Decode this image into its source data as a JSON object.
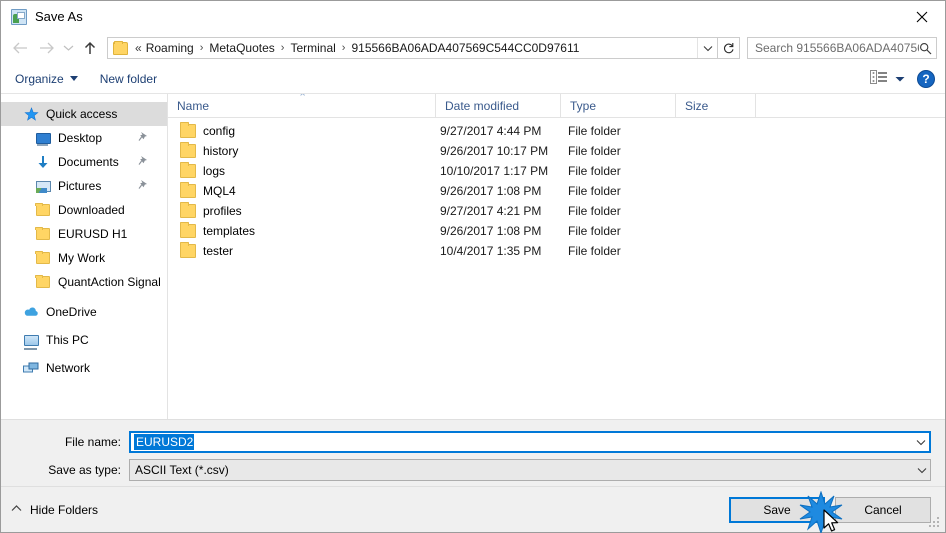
{
  "window": {
    "title": "Save As",
    "title_icon": "save-as-app-icon",
    "close_icon": "close-icon"
  },
  "navigation": {
    "back_icon": "back-arrow-icon",
    "forward_icon": "forward-arrow-icon",
    "recent_icon": "recent-locations-chevron-icon",
    "up_icon": "up-arrow-icon",
    "breadcrumb_folder_icon": "folder-icon",
    "breadcrumb_overflow": "«",
    "breadcrumbs": [
      "Roaming",
      "MetaQuotes",
      "Terminal",
      "915566BA06ADA407569C544CC0D97611"
    ],
    "separator": "›",
    "address_dropdown_icon": "chevron-down-icon",
    "refresh_icon": "refresh-icon"
  },
  "search": {
    "placeholder": "Search 915566BA06ADA40756...",
    "icon": "search-icon"
  },
  "commandbar": {
    "organize": "Organize",
    "new_folder": "New folder",
    "view_icon": "view-layout-icon",
    "view_dropdown_icon": "chevron-down-icon",
    "help_icon": "help-icon",
    "help_label": "?"
  },
  "sidebar": {
    "items": [
      {
        "label": "Quick access",
        "icon": "star-icon",
        "selected": true,
        "indent": false,
        "pinned": false
      },
      {
        "label": "Desktop",
        "icon": "desktop-icon",
        "selected": false,
        "indent": true,
        "pinned": true
      },
      {
        "label": "Documents",
        "icon": "documents-download-icon",
        "selected": false,
        "indent": true,
        "pinned": true
      },
      {
        "label": "Pictures",
        "icon": "pictures-icon",
        "selected": false,
        "indent": true,
        "pinned": true
      },
      {
        "label": "Downloaded",
        "icon": "folder-icon",
        "selected": false,
        "indent": true,
        "pinned": false
      },
      {
        "label": "EURUSD H1",
        "icon": "folder-icon",
        "selected": false,
        "indent": true,
        "pinned": false
      },
      {
        "label": "My Work",
        "icon": "folder-icon",
        "selected": false,
        "indent": true,
        "pinned": false
      },
      {
        "label": "QuantAction Signal",
        "icon": "folder-icon",
        "selected": false,
        "indent": true,
        "pinned": false
      },
      {
        "label": "OneDrive",
        "icon": "onedrive-cloud-icon",
        "selected": false,
        "indent": false,
        "pinned": false
      },
      {
        "label": "This PC",
        "icon": "this-pc-icon",
        "selected": false,
        "indent": false,
        "pinned": false
      },
      {
        "label": "Network",
        "icon": "network-icon",
        "selected": false,
        "indent": false,
        "pinned": false
      }
    ]
  },
  "filelist": {
    "columns": [
      "Name",
      "Date modified",
      "Type",
      "Size"
    ],
    "sort_indicator": "⌃",
    "rows": [
      {
        "name": "config",
        "date": "9/27/2017 4:44 PM",
        "type": "File folder",
        "size": "",
        "icon": "folder-icon"
      },
      {
        "name": "history",
        "date": "9/26/2017 10:17 PM",
        "type": "File folder",
        "size": "",
        "icon": "folder-icon"
      },
      {
        "name": "logs",
        "date": "10/10/2017 1:17 PM",
        "type": "File folder",
        "size": "",
        "icon": "folder-icon"
      },
      {
        "name": "MQL4",
        "date": "9/26/2017 1:08 PM",
        "type": "File folder",
        "size": "",
        "icon": "folder-icon"
      },
      {
        "name": "profiles",
        "date": "9/27/2017 4:21 PM",
        "type": "File folder",
        "size": "",
        "icon": "folder-icon"
      },
      {
        "name": "templates",
        "date": "9/26/2017 1:08 PM",
        "type": "File folder",
        "size": "",
        "icon": "folder-icon"
      },
      {
        "name": "tester",
        "date": "10/4/2017 1:35 PM",
        "type": "File folder",
        "size": "",
        "icon": "folder-icon"
      }
    ]
  },
  "form": {
    "filename_label": "File name:",
    "filename_value": "EURUSD2",
    "filename_dropdown_icon": "chevron-down-icon",
    "filetype_label": "Save as type:",
    "filetype_value": "ASCII Text (*.csv)",
    "filetype_dropdown_icon": "chevron-down-icon"
  },
  "footer": {
    "hide_folders": "Hide Folders",
    "hide_folders_icon": "chevron-up-icon",
    "save_button": "Save",
    "cancel_button": "Cancel",
    "resize_grip_icon": "resize-grip-icon"
  },
  "colors": {
    "accent": "#0078d7",
    "folder": "#ffd564",
    "header_text": "#3a5a8c",
    "selection": "#0078d7"
  }
}
